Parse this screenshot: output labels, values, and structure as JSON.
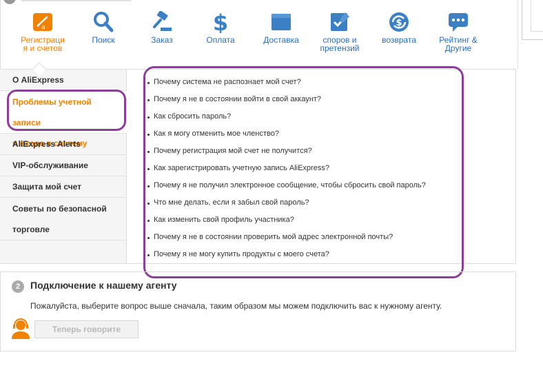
{
  "categories": [
    {
      "label": "Регистраци\nя и счетов",
      "icon": "account-card-icon",
      "active": true
    },
    {
      "label": "Поиск",
      "icon": "search-icon",
      "active": false
    },
    {
      "label": "Заказ",
      "icon": "gavel-icon",
      "active": false
    },
    {
      "label": "Оплата",
      "icon": "dollar-icon",
      "active": false
    },
    {
      "label": "Доставка",
      "icon": "box-icon",
      "active": false
    },
    {
      "label": "споров и\nпретензий",
      "icon": "dispute-check-icon",
      "active": false
    },
    {
      "label": "возврата",
      "icon": "refund-icon",
      "active": false
    },
    {
      "label": "Рейтинг &\nДругие",
      "icon": "chat-bubble-icon",
      "active": false
    }
  ],
  "sidebar": {
    "items": [
      {
        "label": "О AliExpress",
        "active": false
      },
      {
        "label_line1": "Проблемы учетной записи",
        "label_line2": "и входа в систему",
        "active": true
      },
      {
        "label": "AliExpress Alerts",
        "active": false
      },
      {
        "label": "VIP-обслуживание",
        "active": false
      },
      {
        "label": "Защита мой счет",
        "active": false
      },
      {
        "label_line1": "Советы по безопасной",
        "label_line2": "торговле",
        "active": false
      }
    ]
  },
  "questions": [
    "Почему система не распознает мой счет?",
    "Почему я не в состоянии войти в свой аккаунт?",
    "Как сбросить пароль?",
    "Как я могу отменить мое членство?",
    "Почему регистрация мой счет не получится?",
    "Как зарегистрировать учетную запись AliExpress?",
    "Почему я не получил электронное сообщение, чтобы сбросить свой пароль?",
    "Что мне делать, если я забыл свой пароль?",
    "Как изменить свой профиль участника?",
    "Почему я не в состоянии проверить мой адрес электронной почты?",
    "Почему я не могу купить продукты с моего счета?"
  ],
  "agent": {
    "step": "2",
    "title": "Подключение к нашему агенту",
    "description": "Пожалуйста, выберите вопрос выше сначала, таким образом мы можем подключить вас к нужному агенту.",
    "button_label": "Теперь говорите"
  },
  "colors": {
    "accent_orange": "#f08200",
    "link_blue": "#2a6ebb",
    "icon_blue": "#3b7fc4",
    "highlight_purple": "#8b3f98"
  }
}
